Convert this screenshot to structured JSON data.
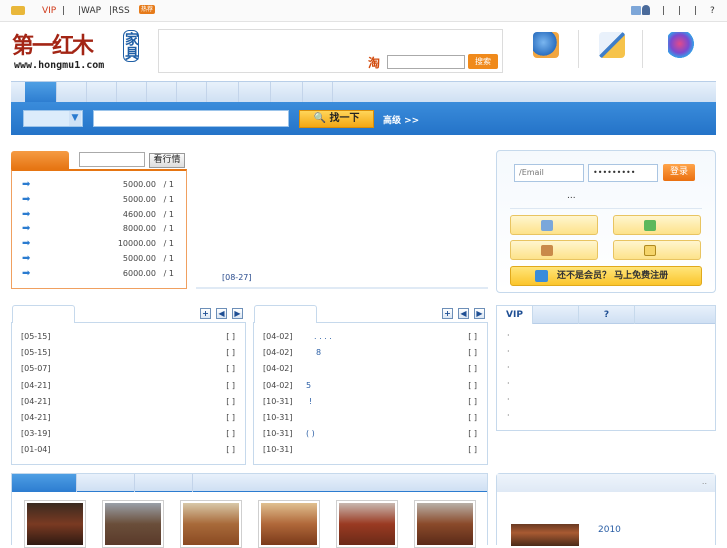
{
  "topbar": {
    "links": [
      "VIP",
      "|",
      "|WAP",
      "|RSS"
    ],
    "right_links": [
      "|",
      "|",
      "|",
      "?"
    ],
    "hot_badge": "热荐"
  },
  "logo": {
    "text": "第一红木",
    "sub": "家具",
    "url": "www.hongmu1.com"
  },
  "taobao": {
    "label": "淘",
    "button": "搜索"
  },
  "search": {
    "button": "找一下",
    "advanced": "高级 >>",
    "dropdown_arrow": "▼"
  },
  "ranking": {
    "button": "看行情",
    "rows": [
      {
        "price": "5000.00",
        "unit": "/ 1"
      },
      {
        "price": "5000.00",
        "unit": "/ 1"
      },
      {
        "price": "4600.00",
        "unit": "/ 1"
      },
      {
        "price": "8000.00",
        "unit": "/ 1"
      },
      {
        "price": "10000.00",
        "unit": "/ 1"
      },
      {
        "price": "5000.00",
        "unit": "/ 1"
      },
      {
        "price": "6000.00",
        "unit": "/ 1"
      }
    ],
    "arrow_icon": "➡"
  },
  "news_date": "[08-27]",
  "login": {
    "email_placeholder": "/Email",
    "password_mask": "•••••••••",
    "login_button": "登录",
    "dots": "...",
    "register": "还不是会员？ 马上免费注册"
  },
  "panel_left": {
    "controls": [
      "+",
      "◀",
      "▶"
    ],
    "rows": [
      {
        "date": "[05-15]",
        "title": "",
        "bracket": "[ ]"
      },
      {
        "date": "[05-15]",
        "title": "",
        "bracket": "[ ]"
      },
      {
        "date": "[05-07]",
        "title": "",
        "bracket": "[ ]"
      },
      {
        "date": "[04-21]",
        "title": "",
        "bracket": "[ ]"
      },
      {
        "date": "[04-21]",
        "title": "",
        "bracket": "[ ]"
      },
      {
        "date": "[04-21]",
        "title": "",
        "bracket": "[ ]"
      },
      {
        "date": "[03-19]",
        "title": "",
        "bracket": "[ ]"
      },
      {
        "date": "[01-04]",
        "title": "",
        "bracket": "[ ]"
      }
    ]
  },
  "panel_mid": {
    "controls": [
      "+",
      "◀",
      "▶"
    ],
    "rows": [
      {
        "date": "[04-02]",
        "title": ". . . .",
        "bracket": "[ ]"
      },
      {
        "date": "[04-02]",
        "title": "8",
        "bracket": "[ ]"
      },
      {
        "date": "[04-02]",
        "title": "",
        "bracket": "[ ]"
      },
      {
        "date": "[04-02]",
        "title": "5",
        "bracket": "[ ]"
      },
      {
        "date": "[10-31]",
        "title": "!",
        "bracket": "[ ]"
      },
      {
        "date": "[10-31]",
        "title": "",
        "bracket": "[ ]"
      },
      {
        "date": "[10-31]",
        "title": "( )",
        "bracket": "[ ]"
      },
      {
        "date": "[10-31]",
        "title": "",
        "bracket": "[ ]"
      }
    ]
  },
  "vip": {
    "tabs": [
      "VIP",
      "",
      "?"
    ],
    "rows": [
      "·",
      "·",
      "·",
      "·",
      "·",
      "·"
    ]
  },
  "right_bottom": {
    "dots": "..",
    "year": "2010"
  }
}
